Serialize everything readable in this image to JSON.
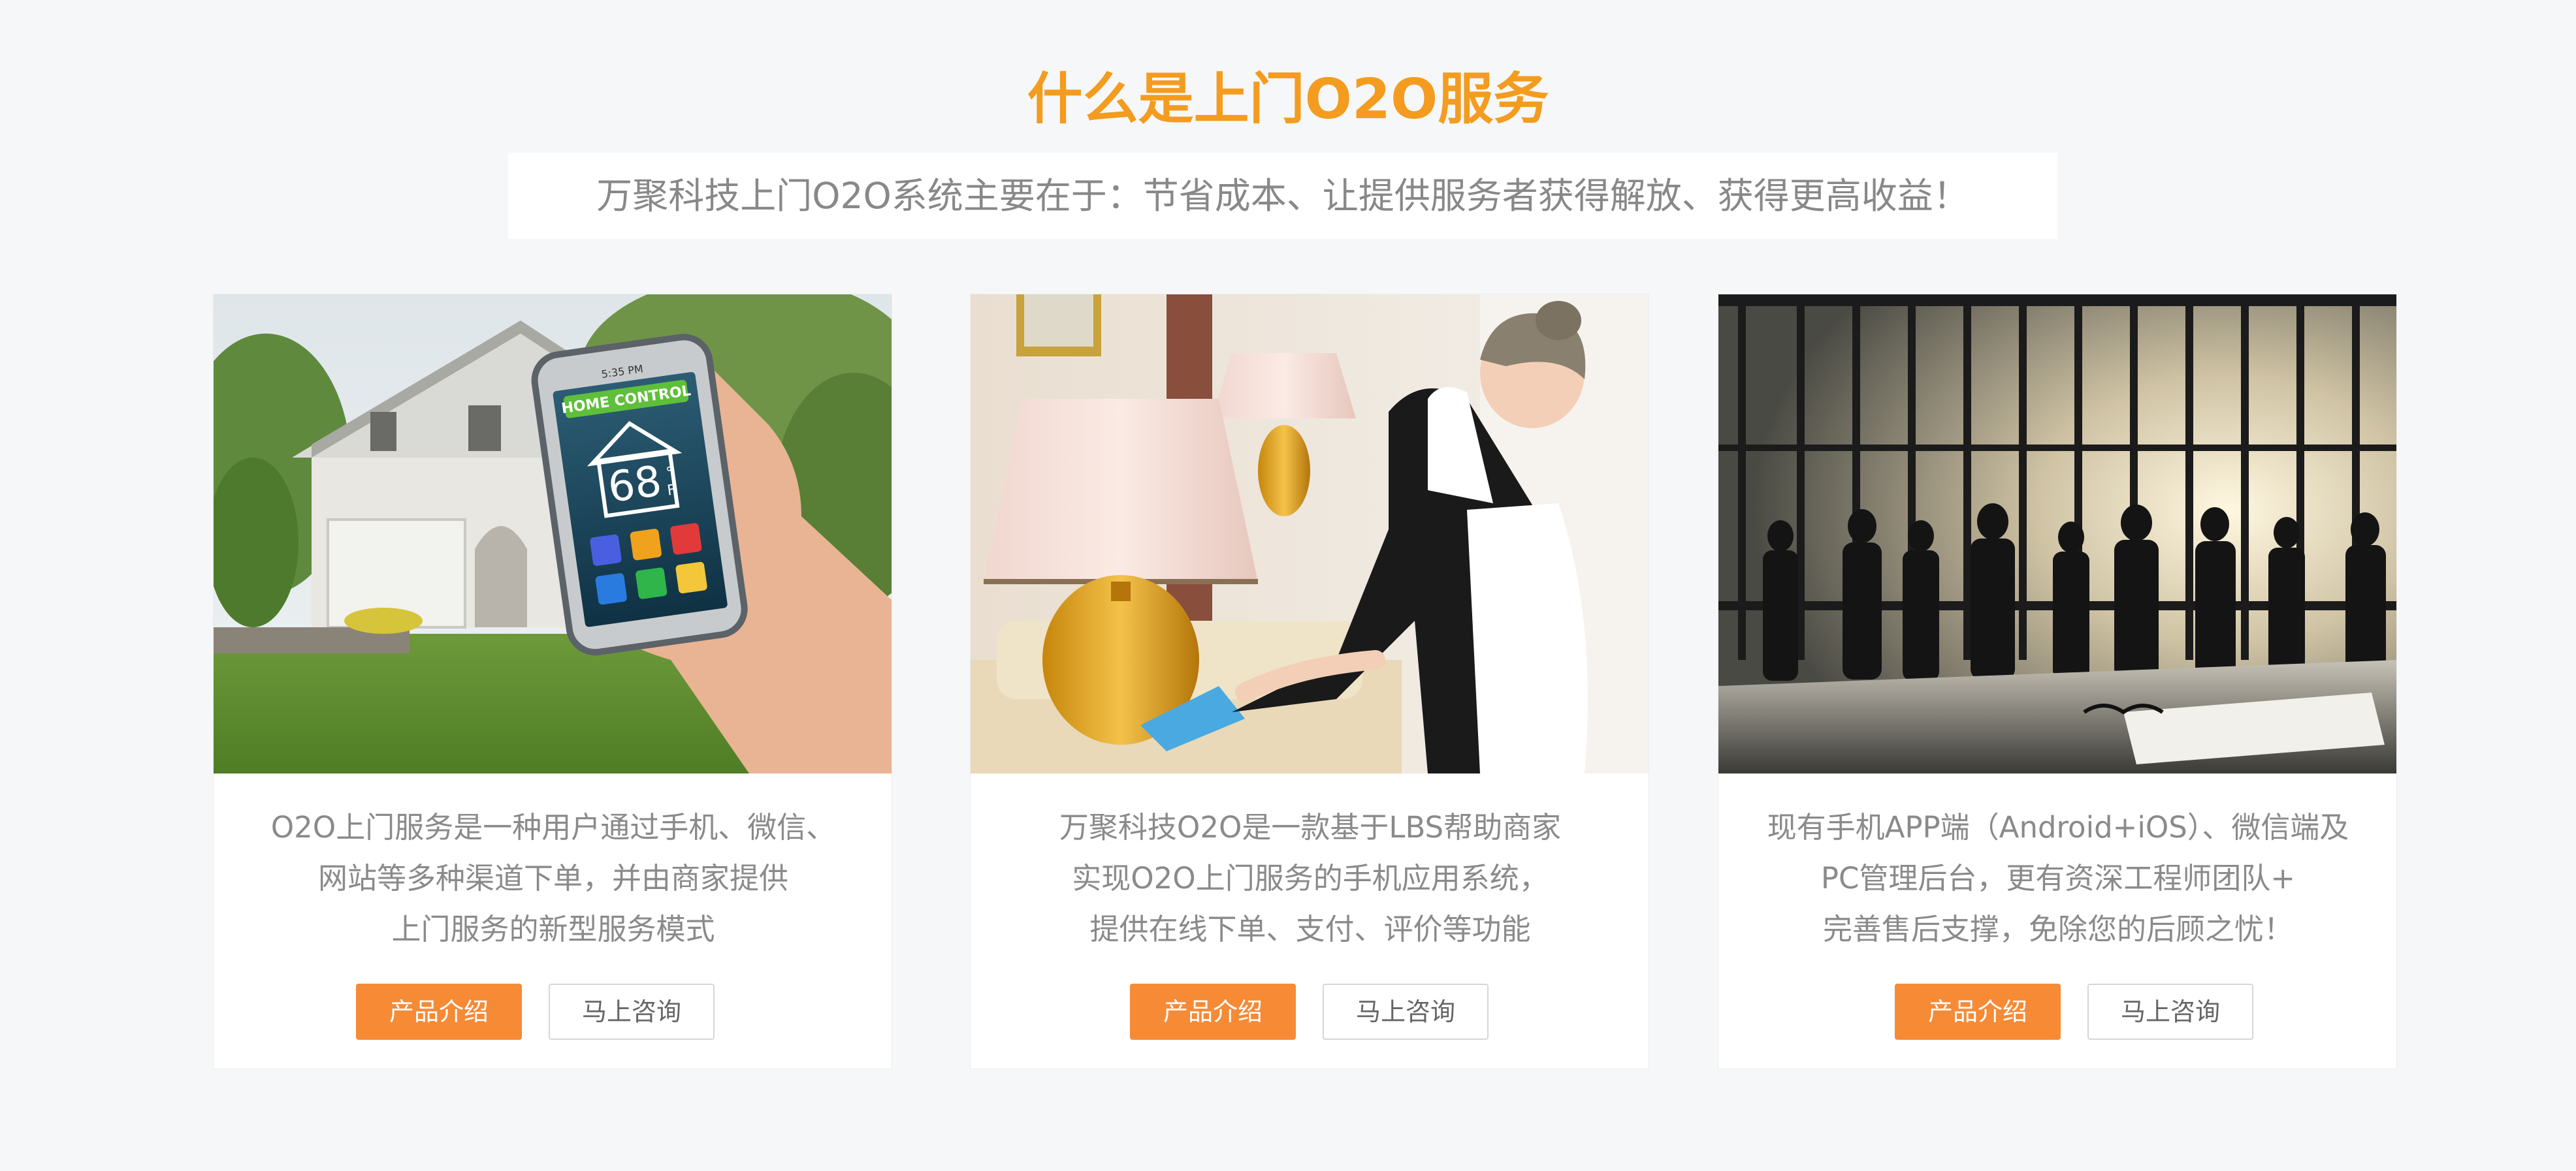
{
  "colors": {
    "accent": "#f39c1f",
    "button": "#f68a35"
  },
  "header": {
    "title": "什么是上门O2O服务",
    "subtitle": "万聚科技上门O2O系统主要在于：节省成本、让提供服务者获得解放、获得更高收益！"
  },
  "cards": [
    {
      "image": "smart-home-phone-image",
      "phone_screen": {
        "time": "5:35 PM",
        "header": "HOME CONTROL",
        "temperature": "68",
        "unit_top": "°",
        "unit_bottom": "F"
      },
      "lines": [
        "O2O上门服务是一种用户通过手机、微信、",
        "网站等多种渠道下单，并由商家提供",
        "上门服务的新型服务模式"
      ],
      "primary_label": "产品介绍",
      "secondary_label": "马上咨询"
    },
    {
      "image": "housekeeping-maid-image",
      "lines": [
        "万聚科技O2O是一款基于LBS帮助商家",
        "实现O2O上门服务的手机应用系统，",
        "提供在线下单、支付、评价等功能"
      ],
      "primary_label": "产品介绍",
      "secondary_label": "马上咨询"
    },
    {
      "image": "business-team-silhouette-image",
      "lines": [
        "现有手机APP端（Android+iOS）、微信端及",
        "PC管理后台，更有资深工程师团队+",
        "完善售后支撑，免除您的后顾之忧！"
      ],
      "primary_label": "产品介绍",
      "secondary_label": "马上咨询"
    }
  ]
}
